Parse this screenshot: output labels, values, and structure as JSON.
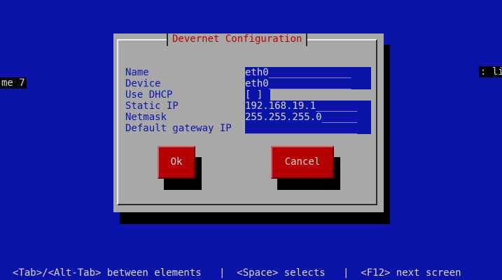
{
  "background_fragments": {
    "left_text": "me 7",
    "right_text": ": li"
  },
  "dialog": {
    "title": "Devernet Configuration",
    "fields": {
      "name": {
        "label": "Name",
        "value": "eth0______________"
      },
      "device": {
        "label": "Device",
        "value": "eth0______________"
      },
      "use_dhcp": {
        "label": "Use DHCP",
        "value": "[ ]"
      },
      "static_ip": {
        "label": "Static IP",
        "value": "192.168.19.1_______"
      },
      "netmask": {
        "label": "Netmask",
        "value": "255.255.255.0______"
      },
      "gateway": {
        "label": "Default gateway IP",
        "value": "___________________"
      }
    },
    "buttons": {
      "ok": "Ok",
      "cancel": "Cancel"
    }
  },
  "helpbar": {
    "text": "<Tab>/<Alt-Tab> between elements   |  <Space> selects   |  <F12> next screen"
  },
  "colors": {
    "screen_bg": "#0b14a8",
    "dialog_bg": "#a8a8a8",
    "title_text": "#b40000",
    "label_text": "#0b14a8",
    "field_bg": "#0b14a8",
    "button_bg": "#b40000",
    "shadow": "#000000"
  }
}
